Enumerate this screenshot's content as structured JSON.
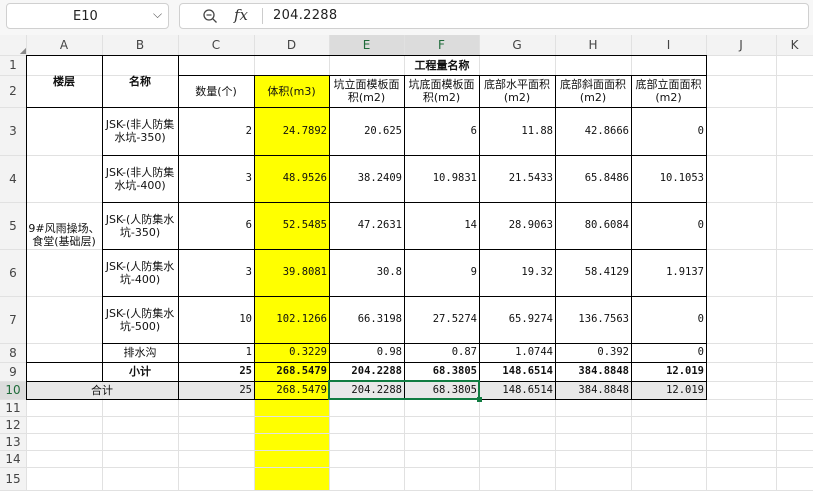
{
  "name_box": "E10",
  "formula_bar": {
    "fx_label": "fx",
    "value": "204.2288"
  },
  "columns": [
    "A",
    "B",
    "C",
    "D",
    "E",
    "F",
    "G",
    "H",
    "I",
    "J",
    "K"
  ],
  "rows": [
    "1",
    "2",
    "3",
    "4",
    "5",
    "6",
    "7",
    "8",
    "9",
    "10",
    "11",
    "12",
    "13",
    "14",
    "15"
  ],
  "header": {
    "group_title": "工程量名称",
    "floor": "楼层",
    "name": "名称",
    "qty": "数量(个)",
    "volume": "体积(m3)",
    "pit_side": "坑立面模板面积(m2)",
    "pit_bottom": "坑底面模板面积(m2)",
    "base_flat": "底部水平面积(m2)",
    "base_slope": "底部斜面面积(m2)",
    "base_vertical": "底部立面面积(m2)"
  },
  "floor_value": "9#风雨操场、食堂(基础层)",
  "data_rows": [
    {
      "name": "JSK-(非人防集水坑-350)",
      "qty": "2",
      "volume": "24.7892",
      "pit_side": "20.625",
      "pit_bottom": "6",
      "base_flat": "11.88",
      "base_slope": "42.8666",
      "base_vertical": "0"
    },
    {
      "name": "JSK-(非人防集水坑-400)",
      "qty": "3",
      "volume": "48.9526",
      "pit_side": "38.2409",
      "pit_bottom": "10.9831",
      "base_flat": "21.5433",
      "base_slope": "65.8486",
      "base_vertical": "10.1053"
    },
    {
      "name": "JSK-(人防集水坑-350)",
      "qty": "6",
      "volume": "52.5485",
      "pit_side": "47.2631",
      "pit_bottom": "14",
      "base_flat": "28.9063",
      "base_slope": "80.6084",
      "base_vertical": "0"
    },
    {
      "name": "JSK-(人防集水坑-400)",
      "qty": "3",
      "volume": "39.8081",
      "pit_side": "30.8",
      "pit_bottom": "9",
      "base_flat": "19.32",
      "base_slope": "58.4129",
      "base_vertical": "1.9137"
    },
    {
      "name": "JSK-(人防集水坑-500)",
      "qty": "10",
      "volume": "102.1266",
      "pit_side": "66.3198",
      "pit_bottom": "27.5274",
      "base_flat": "65.9274",
      "base_slope": "136.7563",
      "base_vertical": "0"
    },
    {
      "name": "排水沟",
      "qty": "1",
      "volume": "0.3229",
      "pit_side": "0.98",
      "pit_bottom": "0.87",
      "base_flat": "1.0744",
      "base_slope": "0.392",
      "base_vertical": "0"
    }
  ],
  "subtotal": {
    "label": "小计",
    "qty": "25",
    "volume": "268.5479",
    "pit_side": "204.2288",
    "pit_bottom": "68.3805",
    "base_flat": "148.6514",
    "base_slope": "384.8848",
    "base_vertical": "12.019"
  },
  "total": {
    "label": "合计",
    "qty": "25",
    "volume": "268.5479",
    "pit_side": "204.2288",
    "pit_bottom": "68.3805",
    "base_flat": "148.6514",
    "base_slope": "384.8848",
    "base_vertical": "12.019"
  },
  "colors": {
    "highlight_yellow": "#ffff00",
    "selection_green": "#107c41",
    "header_gray": "#f3f3f3",
    "total_row_gray": "#e8e8e8",
    "selected_header_text": "#1f6b3a"
  }
}
